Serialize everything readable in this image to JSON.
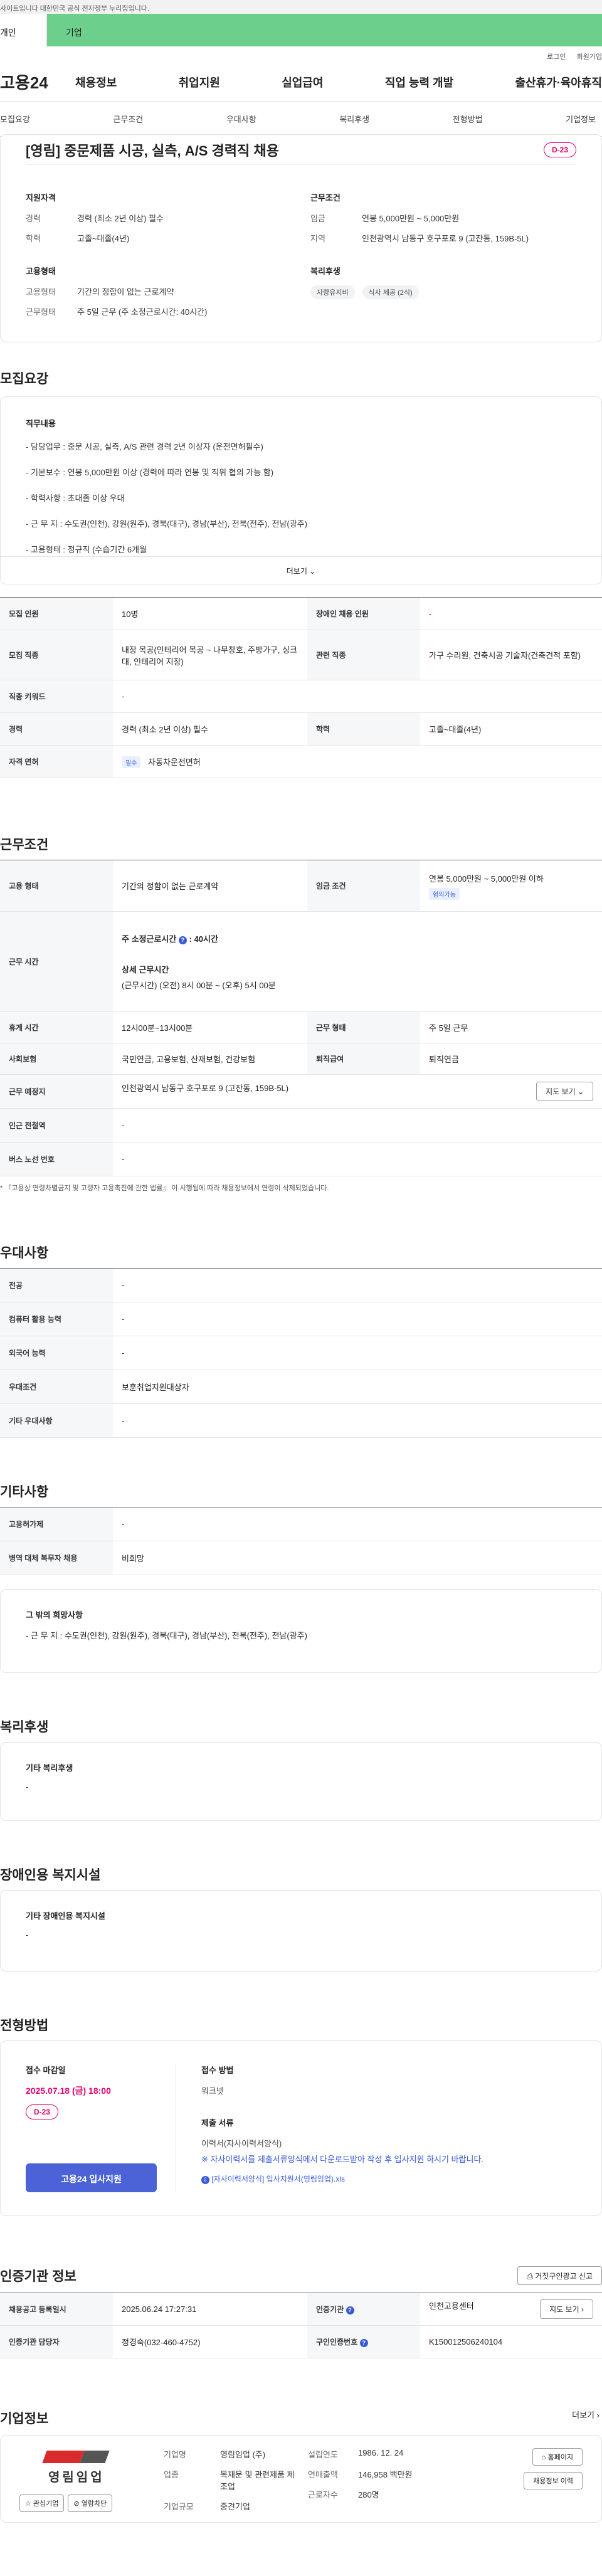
{
  "gov_bar": {
    "text": "사이트입니다 대한민국 공식 전자정부 누리집입니다."
  },
  "tabs": {
    "personal": "개인",
    "company": "기업"
  },
  "util": {
    "login": "로그인",
    "join": "회원가입"
  },
  "gnb": {
    "logo": "고용24",
    "menu": [
      "채용정보",
      "취업지원",
      "실업급여",
      "직업 능력 개발",
      "출산휴가·육아휴직"
    ]
  },
  "subnav": [
    "모집요강",
    "근무조건",
    "우대사항",
    "복리후생",
    "전형방법",
    "기업정보"
  ],
  "summary": {
    "title": "[영림] 중문제품 시공, 실측, A/S 경력직 채용",
    "dday": "D-23",
    "qualification": {
      "heading": "지원자격",
      "rows": [
        {
          "k": "경력",
          "v": "경력 (최소 2년 이상) 필수"
        },
        {
          "k": "학력",
          "v": "고졸~대졸(4년)"
        }
      ]
    },
    "conditions": {
      "heading": "근무조건",
      "rows": [
        {
          "k": "임금",
          "v": "연봉 5,000만원 ~ 5,000만원"
        },
        {
          "k": "지역",
          "v": "인천광역시 남동구 호구포로 9 (고잔동, 159B-5L)"
        }
      ]
    },
    "employment": {
      "heading": "고용형태",
      "rows": [
        {
          "k": "고용형태",
          "v": "기간의 정함이 없는 근로계약"
        },
        {
          "k": "근무형태",
          "v": "주 5일 근무 (주 소정근로시간: 40시간)"
        }
      ]
    },
    "welfare": {
      "heading": "복리후생",
      "chips": [
        "자량유지비",
        "식사 제공 (2식)"
      ]
    }
  },
  "recruit": {
    "heading": "모집요강",
    "job_heading": "직무내용",
    "lines": [
      "- 담당업무 : 중문 시공, 실측, A/S 관련 경력 2년 이상자 (운전면허필수)",
      "- 기본보수 : 연봉 5,000만원 이상 (경력에 따라 연봉 및 직위 협의 가능 함)",
      "- 학력사항 : 초대졸 이상 우대",
      "- 근 무 지 : 수도권(인천), 강원(원주), 경북(대구), 경남(부산), 전북(전주), 전남(광주)",
      "- 고용형태 : 정규직 (수습기간 6개월"
    ],
    "more": "더보기",
    "table": [
      [
        {
          "k": "모집 인원",
          "v": "10명"
        },
        {
          "k": "장애인 채용 인원",
          "v": "-"
        }
      ],
      [
        {
          "k": "모집 직종",
          "v": "내장 목공(인테리어 목공 ~ 나무창호, 주방가구, 싱크대, 인테리어 지장)"
        },
        {
          "k": "관련 직종",
          "v": "가구 수리원, 건축시공 기술자(건축견적 포함)"
        }
      ],
      [
        {
          "k": "직종 키워드",
          "v": "-"
        }
      ],
      [
        {
          "k": "경력",
          "v": "경력 (최소 2년 이상) 필수"
        },
        {
          "k": "학력",
          "v": "고졸~대졸(4년)"
        }
      ],
      [
        {
          "k": "자격 면허",
          "badge": "필수",
          "v": "자동차운전면허"
        }
      ]
    ]
  },
  "work": {
    "heading": "근무조건",
    "type_k": "고용 형태",
    "type_v": "기간의 정함이 없는 근로계약",
    "wage_k": "임금 조건",
    "wage_v": "연봉 5,000만원 ~ 5,000만원 이하",
    "wage_badge": "협의가능",
    "hours_k": "근무 시간",
    "hours_title": "주 소정근로시간",
    "hours_value": ": 40시간",
    "hours_detail_title": "상세 근무시간",
    "hours_detail": "(근무시간) (오전) 8시 00분 ~ (오후) 5시 00분",
    "rest_k": "휴게 시간",
    "rest_v": "12시00분~13시00분",
    "form_k": "근무 형태",
    "form_v": "주 5일 근무",
    "ins_k": "사회보험",
    "ins_v": "국민연금, 고용보험, 산재보험, 건강보험",
    "sev_k": "퇴직급여",
    "sev_v": "퇴직연금",
    "place_k": "근무 예정지",
    "place_v": "인천광역시 남동구 호구포로 9 (고잔동, 159B-5L)",
    "map": "지도 보기",
    "subway_k": "인근 전철역",
    "subway_v": "-",
    "bus_k": "버스 노선 번호",
    "bus_v": "-",
    "note": "* 『고용상 연령차별금지 및 고령자 고용촉진에 관한 법률』 이 시행됨에 따라 채용정보에서 연령이 삭제되었습니다."
  },
  "pref": {
    "heading": "우대사항",
    "rows": [
      {
        "k": "전공",
        "v": "-"
      },
      {
        "k": "컴퓨터 활용 능력",
        "v": "-"
      },
      {
        "k": "외국어 능력",
        "v": "-"
      },
      {
        "k": "우대조건",
        "v": "보훈취업지원대상자"
      },
      {
        "k": "기타 우대사항",
        "v": "-"
      }
    ]
  },
  "etc": {
    "heading": "기타사항",
    "rows": [
      {
        "k": "고용허가제",
        "v": "-"
      },
      {
        "k": "병역 대체 복무자 채용",
        "v": "비희망"
      }
    ],
    "box_title": "그 밖의 희망사항",
    "box_text": "- 근 무 지 : 수도권(인천), 강원(원주), 경북(대구), 경남(부산), 전북(전주), 전남(광주)"
  },
  "welfare": {
    "heading": "복리후생",
    "box_title": "기타 복리후생",
    "box_text": "-"
  },
  "disabled": {
    "heading": "장애인용 복지시설",
    "box_title": "기타 장애인용 복지시설",
    "box_text": "-"
  },
  "selection": {
    "heading": "전형방법",
    "deadline_title": "접수 마감일",
    "deadline": "2025.07.18 (금) 18:00",
    "dday": "D-23",
    "apply": "고용24 입사지원",
    "method_title": "접수 방법",
    "method": "워크넷",
    "docs_title": "제출 서류",
    "docs": "이력서(자사이력서양식)",
    "docs_note": "※ 자사이력서를 제출서류양식에서 다운로드받아 작성 후 입사지원 하시기 바랍니다.",
    "file": "[자사이력서양식] 입사지원서(영림임업).xls"
  },
  "cert": {
    "heading": "인증기관 정보",
    "report": "거짓구인광고 신고",
    "rows": [
      [
        {
          "k": "채용공고 등록일시",
          "v": "2025.06.24 17:27:31"
        },
        {
          "k": "인증기관",
          "v": "인천고용센터",
          "btn": "지도 보기"
        }
      ],
      [
        {
          "k": "인증기관 담당자",
          "v": "정경숙(032-460-4752)"
        },
        {
          "k": "구인인증번호",
          "v": "K150012506240104"
        }
      ]
    ]
  },
  "company": {
    "heading": "기업정보",
    "more": "더보기",
    "logo_text": "영림임업",
    "fav": "관심기업",
    "block": "열람차단",
    "rows1": [
      {
        "k": "기업명",
        "v": "영림임업 (주)"
      },
      {
        "k": "업종",
        "v": "목재문 및 관련제품 제조업"
      },
      {
        "k": "기업규모",
        "v": "중견기업"
      }
    ],
    "rows2": [
      {
        "k": "설립연도",
        "v": "1986. 12. 24"
      },
      {
        "k": "연매출액",
        "v": "146,958 백만원"
      },
      {
        "k": "근로자수",
        "v": "280명"
      }
    ],
    "homepage": "홈페이지",
    "other": "채용정보 이력"
  }
}
